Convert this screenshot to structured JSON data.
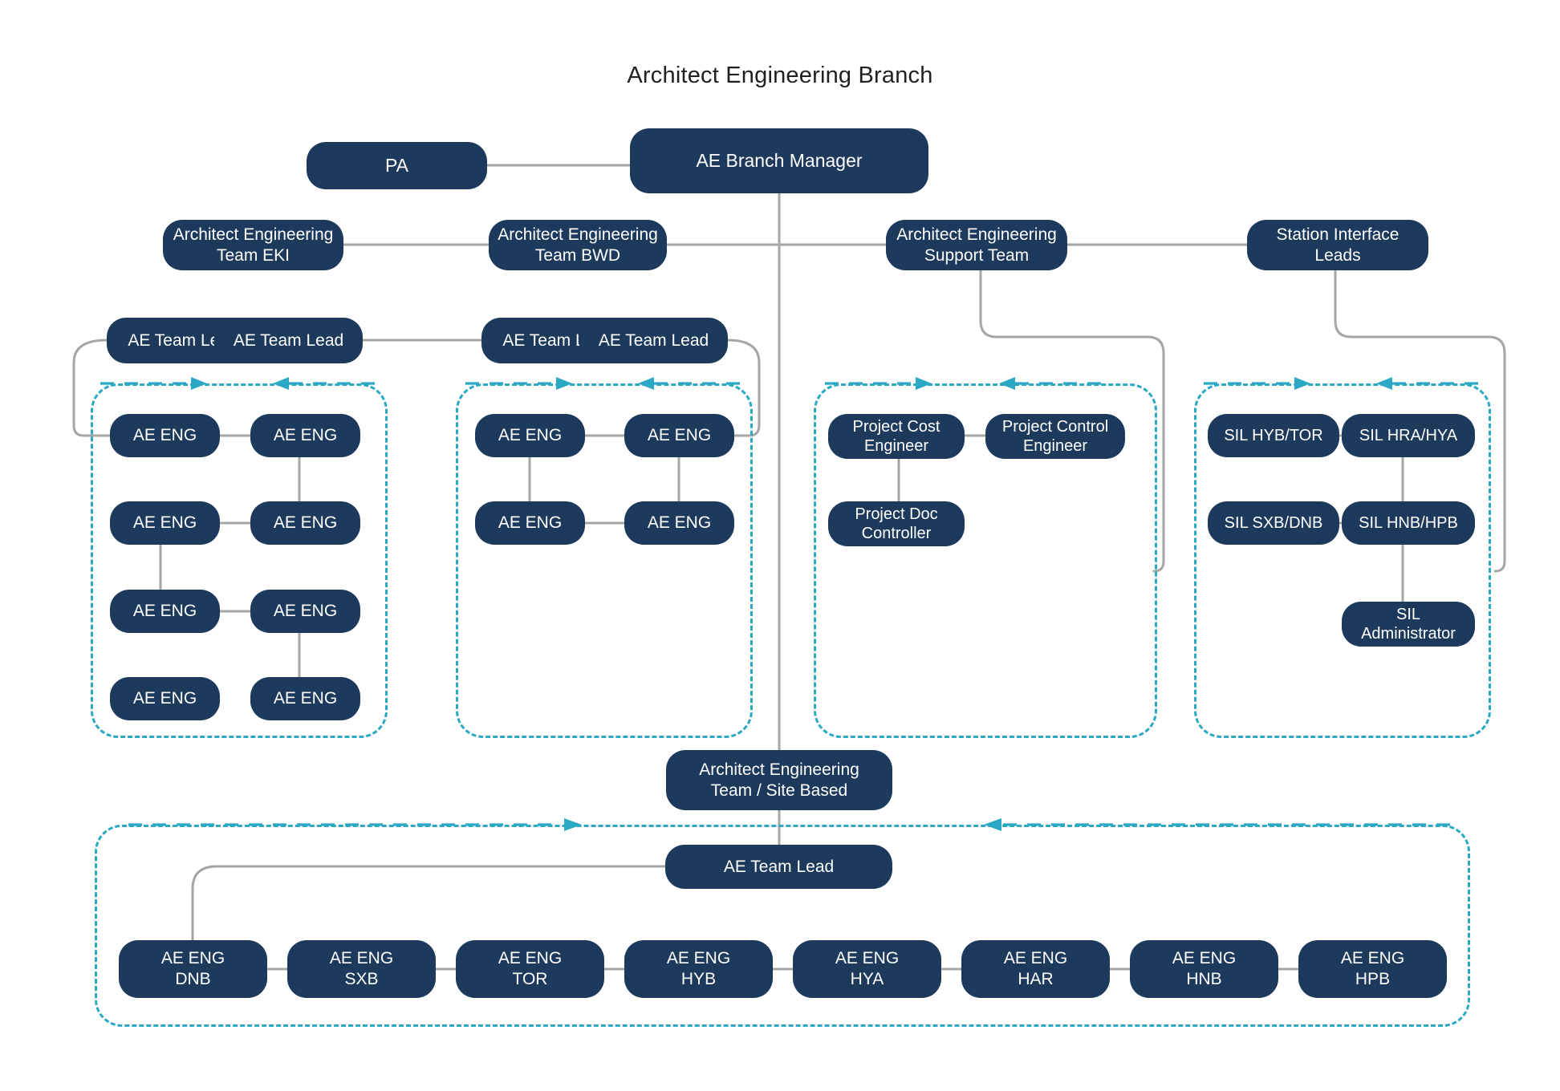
{
  "chart_title": "Architect Engineering Branch",
  "theme": {
    "node_fill": "#1d3a5c",
    "node_text": "#ffffff",
    "dashed_border": "#2ba8c4",
    "connector_line": "#a6a6a6",
    "background": "#ffffff",
    "title_color": "#231f20"
  },
  "nodes": {
    "pa": "PA",
    "branch_manager": "AE Branch Manager",
    "team_eki": "Architect Engineering\nTeam EKI",
    "team_eki_l1": "Architect Engineering",
    "team_eki_l2": "Team EKI",
    "team_bwd_l1": "Architect Engineering",
    "team_bwd_l2": "Team BWD",
    "support_team_l1": "Architect Engineering",
    "support_team_l2": "Support Team",
    "station_interface_leads": "Station Interface Leads",
    "lead_a1": "AE Team Lead",
    "lead_a2": "AE Team Lead",
    "lead_b1": "AE Team Lead",
    "lead_b2": "AE Team Lead",
    "ae_eng": "AE ENG",
    "project_cost_l1": "Project Cost",
    "project_cost_l2": "Engineer",
    "project_control_l1": "Project Control",
    "project_control_l2": "Engineer",
    "project_doc_l1": "Project Doc",
    "project_doc_l2": "Controller",
    "sil_hyb_tor": "SIL HYB/TOR",
    "sil_hra_hya": "SIL HRA/HYA",
    "sil_sxb_dnb": "SIL SXB/DNB",
    "sil_hnb_hpb": "SIL HNB/HPB",
    "sil_admin_l1": "SIL",
    "sil_admin_l2": "Administrator",
    "site_team_l1": "Architect Engineering",
    "site_team_l2": "Team / Site Based",
    "site_lead": "AE Team Lead"
  },
  "eki_engineers": [
    {
      "label": "AE ENG"
    },
    {
      "label": "AE ENG"
    },
    {
      "label": "AE ENG"
    },
    {
      "label": "AE ENG"
    },
    {
      "label": "AE ENG"
    },
    {
      "label": "AE ENG"
    },
    {
      "label": "AE ENG"
    },
    {
      "label": "AE ENG"
    }
  ],
  "bwd_engineers": [
    {
      "label": "AE ENG"
    },
    {
      "label": "AE ENG"
    },
    {
      "label": "AE ENG"
    },
    {
      "label": "AE ENG"
    }
  ],
  "site_engineers": [
    {
      "role": "AE ENG",
      "site": "DNB"
    },
    {
      "role": "AE ENG",
      "site": "SXB"
    },
    {
      "role": "AE ENG",
      "site": "TOR"
    },
    {
      "role": "AE ENG",
      "site": "HYB"
    },
    {
      "role": "AE ENG",
      "site": "HYA"
    },
    {
      "role": "AE ENG",
      "site": "HAR"
    },
    {
      "role": "AE ENG",
      "site": "HNB"
    },
    {
      "role": "AE ENG",
      "site": "HPB"
    }
  ]
}
